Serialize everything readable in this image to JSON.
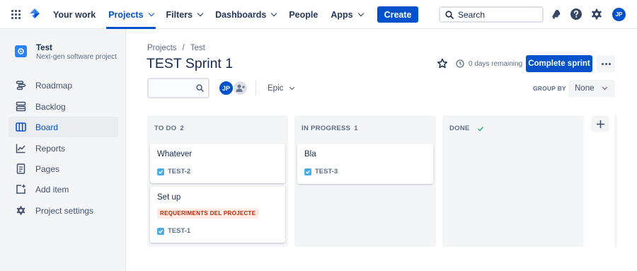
{
  "topnav": {
    "items": [
      {
        "label": "Your work",
        "dropdown": false,
        "active": false
      },
      {
        "label": "Projects",
        "dropdown": true,
        "active": true
      },
      {
        "label": "Filters",
        "dropdown": true,
        "active": false
      },
      {
        "label": "Dashboards",
        "dropdown": true,
        "active": false
      },
      {
        "label": "People",
        "dropdown": false,
        "active": false
      },
      {
        "label": "Apps",
        "dropdown": true,
        "active": false
      }
    ],
    "create_label": "Create",
    "search_label": "Search",
    "user_initials": "JP",
    "icons": [
      "apps-grid-icon",
      "jira-logo-icon",
      "search-icon",
      "notification-icon",
      "help-icon",
      "settings-icon"
    ],
    "accent": "#0052CC"
  },
  "sidebar": {
    "project_name": "Test",
    "project_type": "Next-gen software project",
    "items": [
      {
        "label": "Roadmap",
        "icon": "roadmap-icon",
        "active": false
      },
      {
        "label": "Backlog",
        "icon": "backlog-icon",
        "active": false
      },
      {
        "label": "Board",
        "icon": "board-icon",
        "active": true
      },
      {
        "label": "Reports",
        "icon": "reports-icon",
        "active": false
      },
      {
        "label": "Pages",
        "icon": "pages-icon",
        "active": false
      },
      {
        "label": "Add item",
        "icon": "add-item-icon",
        "active": false
      },
      {
        "label": "Project settings",
        "icon": "settings-icon",
        "active": false
      }
    ]
  },
  "header": {
    "breadcrumbs": [
      "Projects",
      "Test"
    ],
    "title": "TEST Sprint 1",
    "remaining": "0 days remaining",
    "complete_label": "Complete sprint"
  },
  "toolbar": {
    "avatar_initials": "JP",
    "epic_label": "Epic",
    "group_by_label": "GROUP BY",
    "group_by_value": "None"
  },
  "columns": [
    {
      "name": "TO DO",
      "count": "2",
      "cards": [
        {
          "title": "Whatever",
          "key": "TEST-2",
          "epic": ""
        },
        {
          "title": "Set up",
          "key": "TEST-1",
          "epic": "REQUERIMENTS DEL PROJECTE"
        }
      ]
    },
    {
      "name": "IN PROGRESS",
      "count": "1",
      "cards": [
        {
          "title": "Bla",
          "key": "TEST-3",
          "epic": ""
        }
      ]
    },
    {
      "name": "DONE",
      "count": "",
      "cards": []
    }
  ],
  "colors": {
    "epic_bg": "#FFEBE6",
    "epic_text": "#BF2600",
    "task_icon": "#4BADE8",
    "done_check": "#36B37E"
  }
}
